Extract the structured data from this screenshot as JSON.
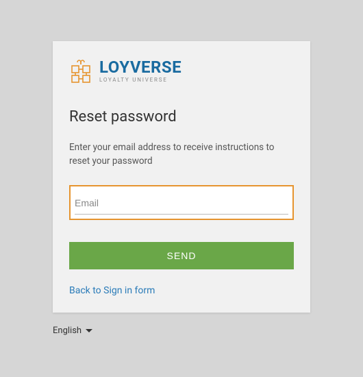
{
  "logo": {
    "brand": "LOYVERSE",
    "tagline": "LOYALTY UNIVERSE"
  },
  "heading": "Reset password",
  "description": "Enter your email address to receive instructions to reset your password",
  "email": {
    "placeholder": "Email",
    "value": ""
  },
  "send_button_label": "SEND",
  "back_link_label": "Back to Sign in form",
  "language": {
    "selected": "English"
  },
  "colors": {
    "accent_orange": "#e6942e",
    "primary_green": "#6aa748",
    "brand_blue": "#1a6ba0",
    "link_blue": "#2a7bb8"
  }
}
